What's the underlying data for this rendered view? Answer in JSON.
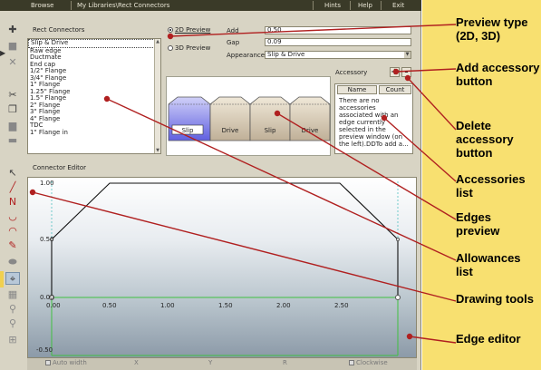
{
  "topbar": {
    "browse": "Browse",
    "path": "My Libraries\\Rect Connectors",
    "hints": "Hints",
    "help": "Help",
    "exit": "Exit"
  },
  "left_panel": {
    "title": "Rect Connectors",
    "items": [
      "Slip & Drive",
      "Raw edge",
      "Ductmate",
      "End cap",
      "1/2\" Flange",
      "3/4\" Flange",
      "1\" Flange",
      "1.25\" Flange",
      "1.5\" Flange",
      "2\" Flange",
      "3\" Flange",
      "4\" Flange",
      "TDC",
      "1\" Flange in"
    ]
  },
  "preview_opts": {
    "opt2d": "2D Preview",
    "opt3d": "3D Preview",
    "add_label": "Add",
    "add_value": "0.50",
    "gap_label": "Gap",
    "gap_value": "0.09",
    "appearance_label": "Appearance",
    "appearance_value": "Slip & Drive"
  },
  "preview": {
    "labels": [
      "Slip",
      "Drive",
      "Slip",
      "Drive"
    ]
  },
  "accessory": {
    "title": "Accessory",
    "add": "+",
    "delete": "-",
    "col_name": "Name",
    "col_count": "Count",
    "message": "There are no accessories associated with an edge currently selected in the preview window (on the left).DDTo add a..."
  },
  "editor": {
    "title": "Connector Editor",
    "y_ticks": [
      "1.00",
      "0.50",
      "0.00",
      "-0.50"
    ],
    "x_ticks": [
      "0.00",
      "0.50",
      "1.00",
      "1.50",
      "2.00",
      "2.50"
    ]
  },
  "bottombar": {
    "autowidth": "Auto width",
    "x": "X",
    "y": "Y",
    "r": "R",
    "clockwise": "Clockwise"
  },
  "callouts": {
    "preview_type": "Preview type (2D, 3D)",
    "add_acc": "Add accessory button",
    "del_acc": "Delete accessory button",
    "acc_list": "Accessories list",
    "edges": "Edges preview",
    "allowances": "Allowances list",
    "drawing_tools": "Drawing tools",
    "edge_editor": "Edge editor"
  },
  "colors": {
    "callout_bg": "#f8e070",
    "accent_line": "#b02020",
    "preview_slip": "#7c7ce8"
  },
  "icons": {
    "tools": [
      "new-connector-icon",
      "stop-icon",
      "delete-icon",
      "cut-icon",
      "copy-icon",
      "document-icon",
      "paste-icon",
      "pointer-icon",
      "line-tool-icon",
      "curve-tool-icon",
      "arc-tool-icon",
      "arc2-tool-icon",
      "pencil-icon",
      "eraser-icon",
      "crosshair-icon",
      "grid-icon",
      "zoom-in-icon",
      "zoom-out-icon",
      "fit-icon"
    ]
  }
}
